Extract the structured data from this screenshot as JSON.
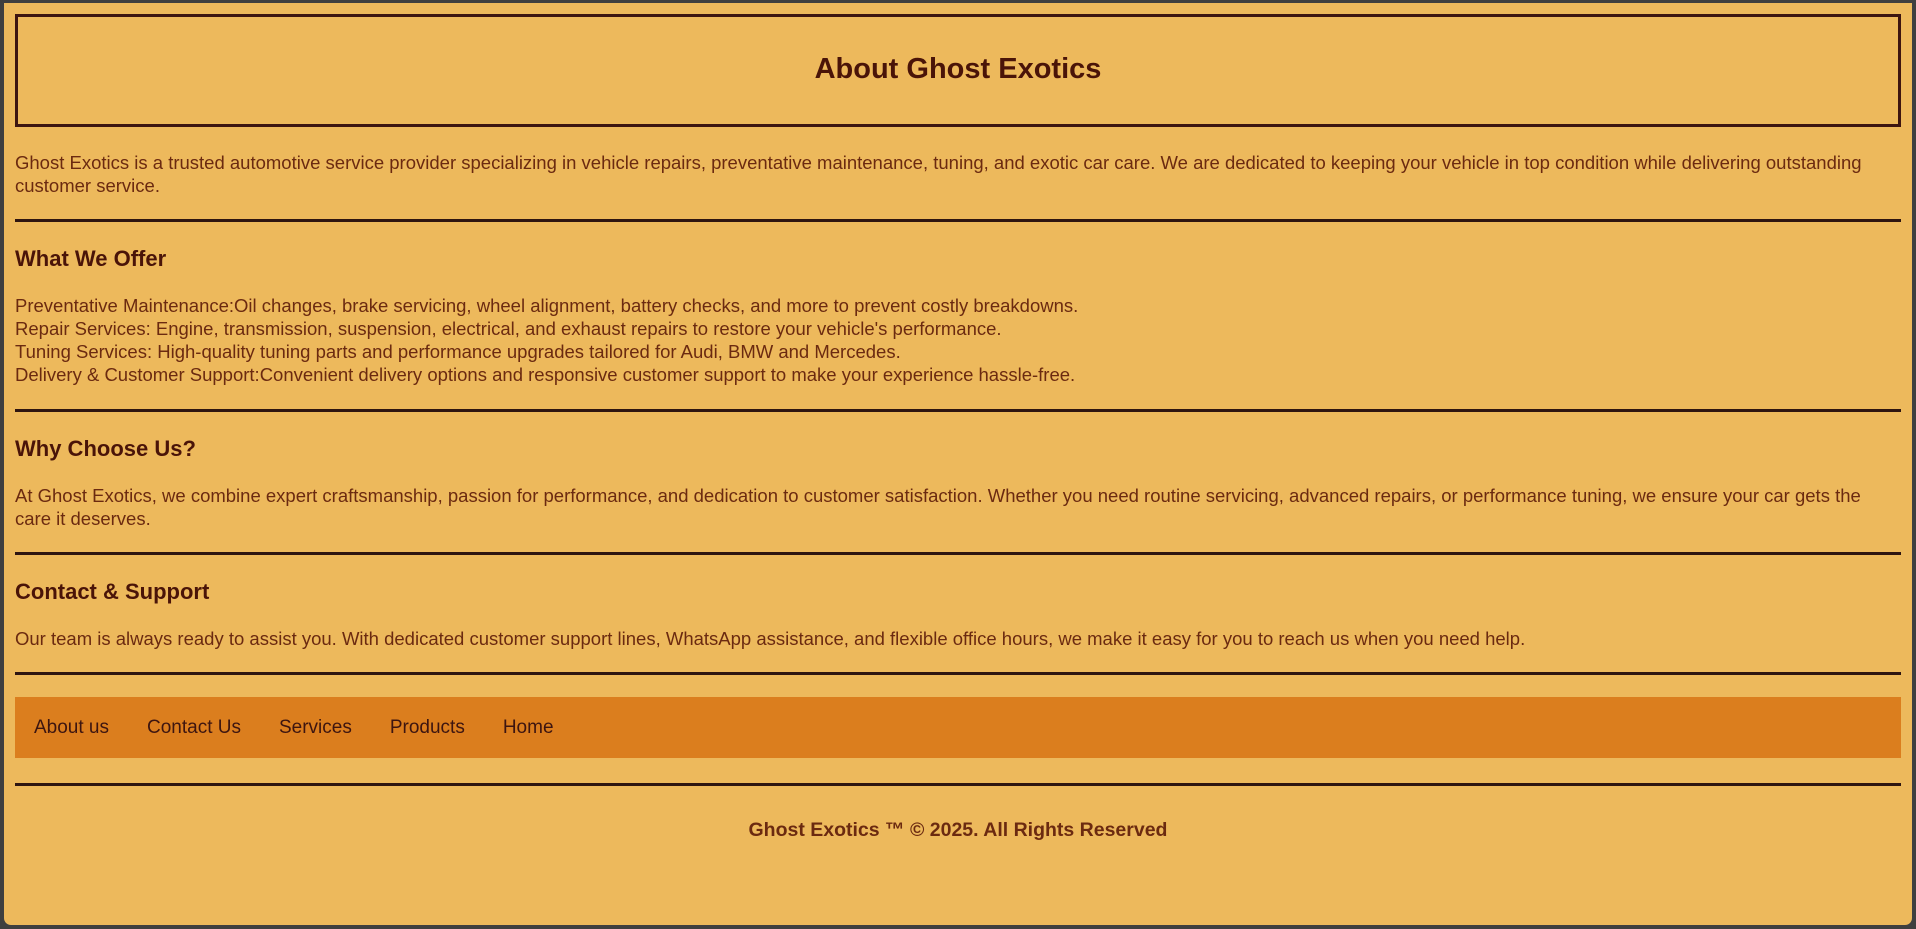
{
  "header": {
    "title": "About Ghost Exotics"
  },
  "intro": {
    "text": "Ghost Exotics is a trusted automotive service provider specializing in vehicle repairs, preventative maintenance, tuning, and exotic car care. We are dedicated to keeping your vehicle in top condition while delivering outstanding customer service."
  },
  "offer": {
    "heading": "What We Offer",
    "items": [
      "Preventative Maintenance:Oil changes, brake servicing, wheel alignment, battery checks, and more to prevent costly breakdowns.",
      "Repair Services: Engine, transmission, suspension, electrical, and exhaust repairs to restore your vehicle's performance.",
      "Tuning Services: High-quality tuning parts and performance upgrades tailored for Audi, BMW and Mercedes.",
      "Delivery & Customer Support:Convenient delivery options and responsive customer support to make your experience hassle-free."
    ]
  },
  "why": {
    "heading": "Why Choose Us?",
    "text": "At Ghost Exotics, we combine expert craftsmanship, passion for performance, and dedication to customer satisfaction. Whether you need routine servicing, advanced repairs, or performance tuning, we ensure your car gets the care it deserves."
  },
  "contact": {
    "heading": "Contact & Support",
    "text": "Our team is always ready to assist you. With dedicated customer support lines, WhatsApp assistance, and flexible office hours, we make it easy for you to reach us when you need help."
  },
  "nav": {
    "links": [
      "About us",
      "Contact Us",
      "Services",
      "Products",
      "Home"
    ]
  },
  "footer": {
    "text": "Ghost Exotics ™ © 2025. All Rights Reserved"
  },
  "colors": {
    "background": "#edb95c",
    "nav_bar": "#db7e1e",
    "text": "#6b2a10",
    "heading": "#4a1408",
    "rule": "#2e1510"
  }
}
